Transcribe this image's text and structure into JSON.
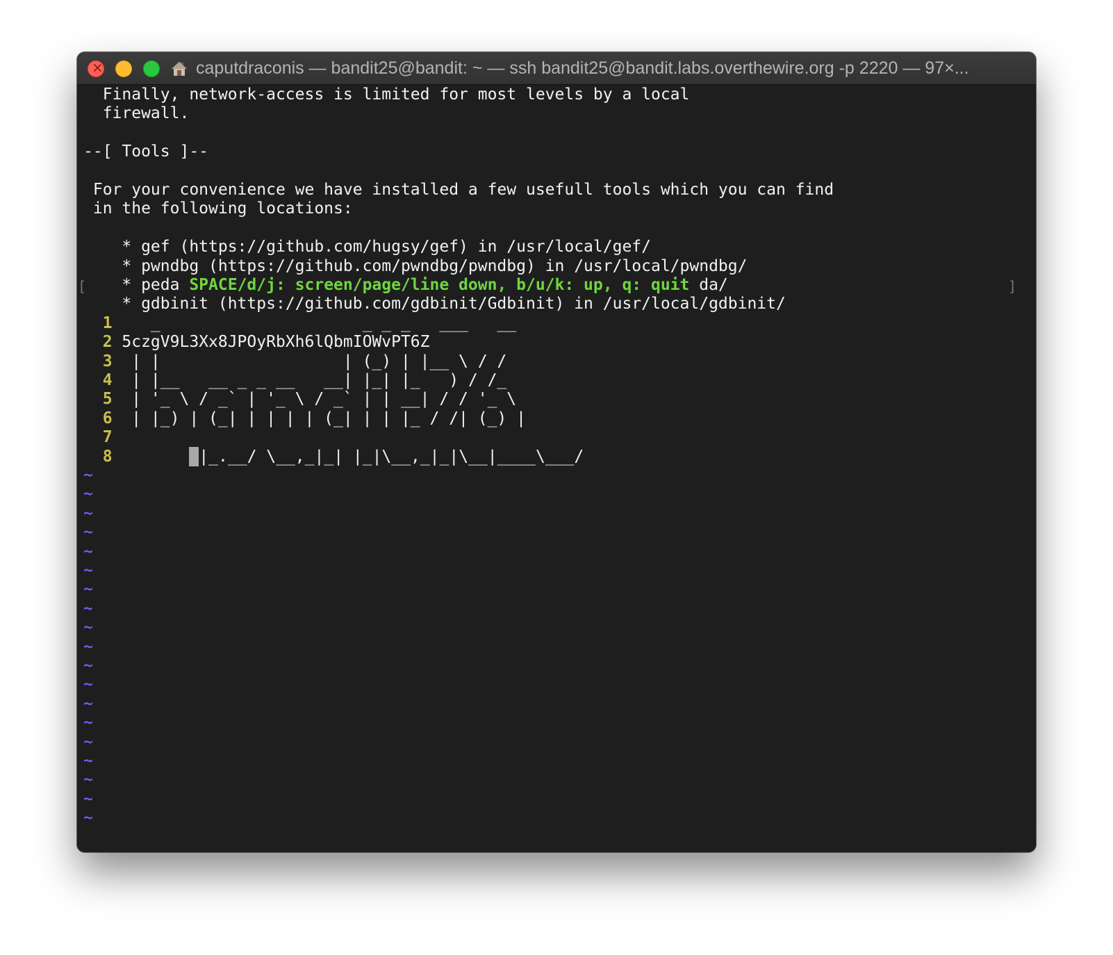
{
  "window": {
    "title": "caputdraconis — bandit25@bandit: ~ — ssh bandit25@bandit.labs.overthewire.org -p 2220 — 97×..."
  },
  "terminal": {
    "text_lines": [
      "  Finally, network-access is limited for most levels by a local",
      "  firewall.",
      "",
      "--[ Tools ]--",
      "",
      " For your convenience we have installed a few usefull tools which you can find",
      " in the following locations:",
      "",
      "    * gef (https://github.com/hugsy/gef) in /usr/local/gef/",
      "    * pwndbg (https://github.com/pwndbg/pwndbg) in /usr/local/pwndbg/"
    ],
    "peda_prefix": "    * peda ",
    "pager_hint": "SPACE/d/j: screen/page/line down, b/u/k: up, q: quit",
    "peda_suffix": " da/",
    "gdbinit_line": "    * gdbinit (https://github.com/gdbinit/Gdbinit) in /usr/local/gdbinit/",
    "left_bracket": "[",
    "right_bracket": "]",
    "vi_lines": [
      {
        "num": "1",
        "text": "   _                     _ _ _   ___   __"
      },
      {
        "num": "2",
        "text": "5czgV9L3Xx8JPOyRbXh6lQbmIOWvPT6Z"
      },
      {
        "num": "3",
        "text": " | |                   | (_) | |__ \\ / /"
      },
      {
        "num": "4",
        "text": " | |__   __ _ _ __   __| |_| |_   ) / /_"
      },
      {
        "num": "5",
        "text": " | '_ \\ / _` | '_ \\ / _` | | __| / / '_ \\"
      },
      {
        "num": "6",
        "text": " | |_) | (_| | | | | (_| | | |_ / /| (_) |"
      },
      {
        "num": "7",
        "text": ""
      },
      {
        "num": "8",
        "text": "|_.__/ \\__,_|_| |_|\\__,_|_|\\__|____\\___/"
      }
    ],
    "line8_indent": "       ",
    "tilde_char": "~",
    "tilde_count": 19
  },
  "colors": {
    "terminal_bg": "#1e1e1e",
    "line_number": "#c8bf4c",
    "pager_hint": "#6fd640",
    "tilde": "#6d5cf0"
  }
}
